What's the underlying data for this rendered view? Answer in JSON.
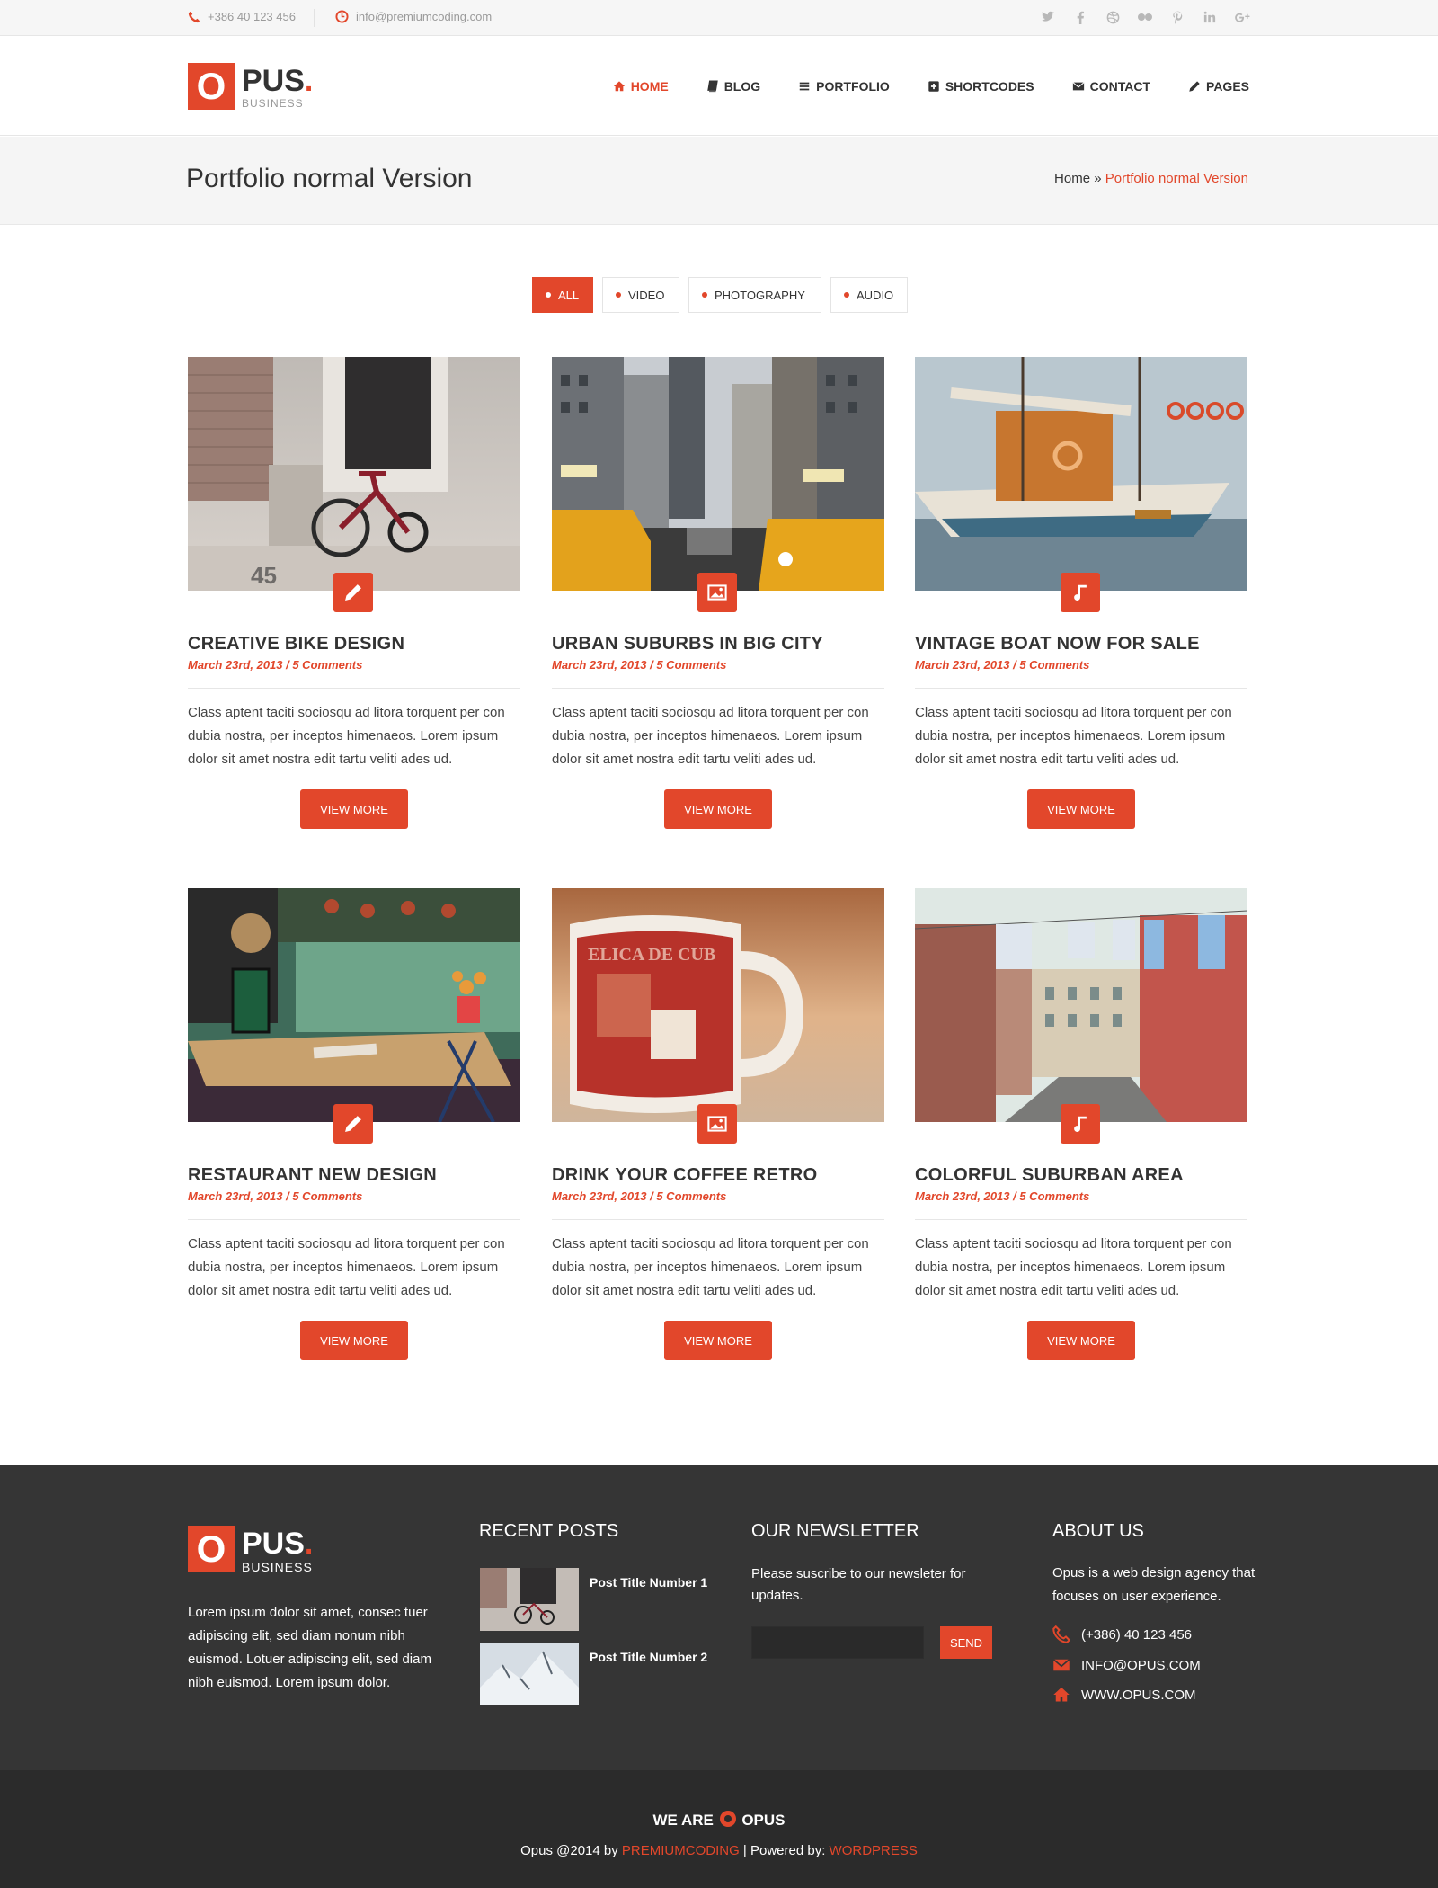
{
  "topbar": {
    "phone": "+386 40 123 456",
    "email": "info@premiumcoding.com",
    "social": [
      "twitter-icon",
      "facebook-icon",
      "dribbble-icon",
      "flickr-icon",
      "pinterest-icon",
      "linkedin-icon",
      "google-plus-icon"
    ]
  },
  "logo": {
    "letter": "O",
    "word": "PUS",
    "dot": ".",
    "sub": "BUSINESS"
  },
  "nav": {
    "items": [
      {
        "label": "HOME",
        "icon": "home-icon"
      },
      {
        "label": "BLOG",
        "icon": "book-icon"
      },
      {
        "label": "PORTFOLIO",
        "icon": "list-icon"
      },
      {
        "label": "SHORTCODES",
        "icon": "plus-square-icon"
      },
      {
        "label": "CONTACT",
        "icon": "envelope-icon"
      },
      {
        "label": "PAGES",
        "icon": "pencil-icon"
      }
    ]
  },
  "page": {
    "title": "Portfolio normal Version",
    "breadcrumb": {
      "home": "Home",
      "sep": " » ",
      "current": "Portfolio normal Version"
    }
  },
  "filters": [
    "ALL",
    "VIDEO",
    "PHOTOGRAPHY",
    "AUDIO"
  ],
  "cards": [
    {
      "title": "CREATIVE BIKE DESIGN",
      "meta": "March 23rd, 2013 / 5 Comments",
      "text": "Class aptent taciti sociosqu ad litora torquent per con dubia nostra, per inceptos himenaeos. Lorem ipsum dolor sit amet nostra edit tartu veliti ades ud.",
      "button": "VIEW MORE",
      "badge": "pencil-icon"
    },
    {
      "title": "URBAN SUBURBS IN BIG CITY",
      "meta": "March 23rd, 2013 / 5 Comments",
      "text": "Class aptent taciti sociosqu ad litora torquent per con dubia nostra, per inceptos himenaeos. Lorem ipsum dolor sit amet nostra edit tartu veliti ades ud.",
      "button": "VIEW MORE",
      "badge": "image-icon"
    },
    {
      "title": "VINTAGE BOAT NOW FOR SALE",
      "meta": "March 23rd, 2013 / 5 Comments",
      "text": "Class aptent taciti sociosqu ad litora torquent per con dubia nostra, per inceptos himenaeos. Lorem ipsum dolor sit amet nostra edit tartu veliti ades ud.",
      "button": "VIEW MORE",
      "badge": "music-note-icon"
    },
    {
      "title": "RESTAURANT NEW DESIGN",
      "meta": "March 23rd, 2013 / 5 Comments",
      "text": "Class aptent taciti sociosqu ad litora torquent per con dubia nostra, per inceptos himenaeos. Lorem ipsum dolor sit amet nostra edit tartu veliti ades ud.",
      "button": "VIEW MORE",
      "badge": "pencil-icon"
    },
    {
      "title": "DRINK YOUR COFFEE RETRO",
      "meta": "March 23rd, 2013 / 5 Comments",
      "text": "Class aptent taciti sociosqu ad litora torquent per con dubia nostra, per inceptos himenaeos. Lorem ipsum dolor sit amet nostra edit tartu veliti ades ud.",
      "button": "VIEW MORE",
      "badge": "image-icon"
    },
    {
      "title": "COLORFUL SUBURBAN AREA",
      "meta": "March 23rd, 2013 / 5 Comments",
      "text": "Class aptent taciti sociosqu ad litora torquent per con dubia nostra, per inceptos himenaeos. Lorem ipsum dolor sit amet nostra edit tartu veliti ades ud.",
      "button": "VIEW MORE",
      "badge": "music-note-icon"
    }
  ],
  "footer": {
    "logo": {
      "letter": "O",
      "word": "PUS",
      "dot": ".",
      "sub": "BUSINESS"
    },
    "about_text": "Lorem ipsum dolor sit amet, consec tuer adipiscing elit, sed diam nonum nibh euismod. Lotuer adipiscing elit, sed diam nibh euismod. Lorem ipsum dolor.",
    "recent": {
      "heading": "RECENT POSTS",
      "posts": [
        "Post Title Number 1",
        "Post Title Number 2"
      ]
    },
    "newsletter": {
      "heading": "OUR NEWSLETTER",
      "text": "Please suscribe to our newsleter for updates.",
      "button": "SEND"
    },
    "about": {
      "heading": "ABOUT US",
      "text": "Opus is a web design agency that focuses on user experience.",
      "phone": "(+386) 40 123 456",
      "email": "INFO@OPUS.COM",
      "web": "WWW.OPUS.COM"
    }
  },
  "bottom": {
    "we_are": "WE ARE",
    "brand": "OPUS",
    "copy_prefix": "Opus @2014 by ",
    "copy_link1": "PREMIUMCODING",
    "copy_mid": " | Powered by: ",
    "copy_link2": "WORDPRESS"
  },
  "colors": {
    "accent": "#e2472b",
    "footer": "#353535",
    "bottom": "#2b2b2b"
  }
}
